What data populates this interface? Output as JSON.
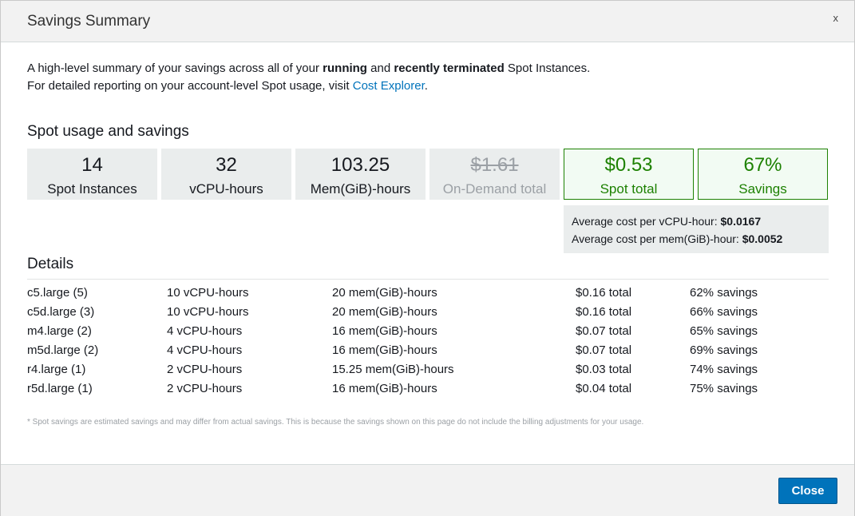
{
  "modal": {
    "title": "Savings Summary",
    "close_x": "x"
  },
  "intro": {
    "line1_pre": "A high-level summary of your savings across all of your ",
    "line1_bold1": "running",
    "line1_mid": " and ",
    "line1_bold2": "recently terminated",
    "line1_post": " Spot Instances.",
    "line2_pre": "For detailed reporting on your account-level Spot usage, visit ",
    "line2_link": "Cost Explorer",
    "line2_post": "."
  },
  "usage": {
    "title": "Spot usage and savings",
    "tiles": [
      {
        "value": "14",
        "label": "Spot Instances"
      },
      {
        "value": "32",
        "label": "vCPU-hours"
      },
      {
        "value": "103.25",
        "label": "Mem(GiB)-hours"
      },
      {
        "value": "$1.61",
        "label": "On-Demand total"
      },
      {
        "value": "$0.53",
        "label": "Spot total"
      },
      {
        "value": "67%",
        "label": "Savings"
      }
    ],
    "avg_vcpu_label": "Average cost per vCPU-hour: ",
    "avg_vcpu_value": "$0.0167",
    "avg_mem_label": "Average cost per mem(GiB)-hour: ",
    "avg_mem_value": "$0.0052"
  },
  "details": {
    "title": "Details",
    "rows": [
      {
        "type": "c5.large (5)",
        "vcpu": "10 vCPU-hours",
        "mem": "20 mem(GiB)-hours",
        "total": "$0.16 total",
        "savings": "62% savings"
      },
      {
        "type": "c5d.large (3)",
        "vcpu": "10 vCPU-hours",
        "mem": "20 mem(GiB)-hours",
        "total": "$0.16 total",
        "savings": "66% savings"
      },
      {
        "type": "m4.large (2)",
        "vcpu": "4 vCPU-hours",
        "mem": "16 mem(GiB)-hours",
        "total": "$0.07 total",
        "savings": "65% savings"
      },
      {
        "type": "m5d.large (2)",
        "vcpu": "4 vCPU-hours",
        "mem": "16 mem(GiB)-hours",
        "total": "$0.07 total",
        "savings": "69% savings"
      },
      {
        "type": "r4.large (1)",
        "vcpu": "2 vCPU-hours",
        "mem": "15.25 mem(GiB)-hours",
        "total": "$0.03 total",
        "savings": "74% savings"
      },
      {
        "type": "r5d.large (1)",
        "vcpu": "2 vCPU-hours",
        "mem": "16 mem(GiB)-hours",
        "total": "$0.04 total",
        "savings": "75% savings"
      }
    ],
    "footnote": "* Spot savings are estimated savings and may differ from actual savings. This is because the savings shown on this page do not include the billing adjustments for your usage."
  },
  "footer": {
    "close_label": "Close"
  },
  "colors": {
    "accent": "#0073bb",
    "savings_green": "#1d8102",
    "tile_gray": "#eaeded",
    "muted_text": "#9ba0a5"
  }
}
